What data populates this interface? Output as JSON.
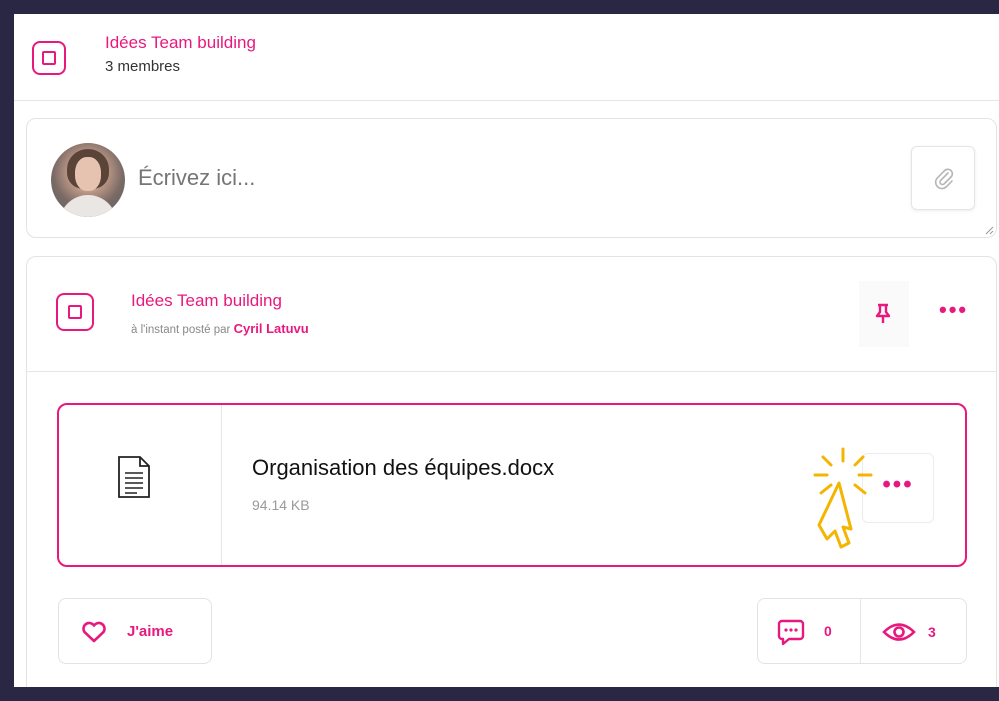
{
  "colors": {
    "accent": "#e8197e",
    "cursor": "#f4b400",
    "background": "#2a2745"
  },
  "group": {
    "name": "Idées Team building",
    "members": "3 membres"
  },
  "composer": {
    "placeholder": "Écrivez ici...",
    "attach_icon": "paperclip-icon"
  },
  "post": {
    "group_name": "Idées Team building",
    "time_text": "à l'instant posté par",
    "author": "Cyril Latuvu",
    "pin_icon": "pin-icon",
    "more_icon": "more-dots-icon",
    "more_label": "•••",
    "file": {
      "name": "Organisation des équipes.docx",
      "size": "94.14 KB",
      "icon": "document-icon",
      "more_label": "•••"
    },
    "like_label": "J'aime",
    "comments_count": "0",
    "views_count": "3"
  }
}
